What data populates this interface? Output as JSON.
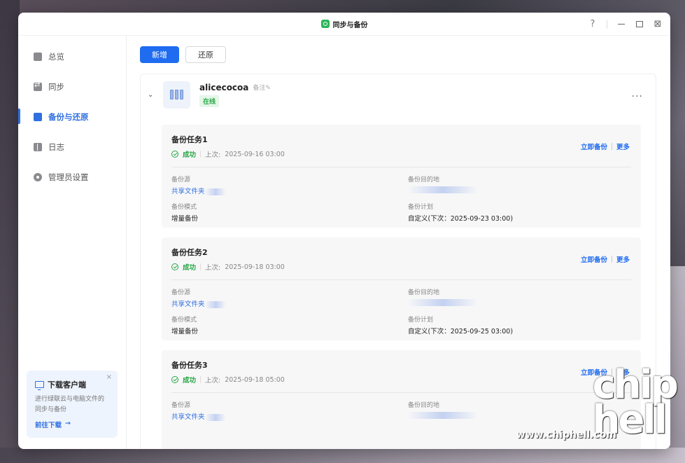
{
  "window": {
    "title": "同步与备份",
    "help": "?"
  },
  "sidebar": {
    "items": [
      {
        "label": "总览",
        "icon": "overview-icon"
      },
      {
        "label": "同步",
        "icon": "sync-icon"
      },
      {
        "label": "备份与还原",
        "icon": "backup-icon",
        "active": true
      },
      {
        "label": "日志",
        "icon": "log-icon"
      },
      {
        "label": "管理员设置",
        "icon": "gear-icon"
      }
    ],
    "download_card": {
      "title": "下载客户端",
      "desc": "进行绿联云与电脑文件的同步与备份",
      "link": "前往下载",
      "arrow": "→",
      "close": "×"
    }
  },
  "toolbar": {
    "add_label": "新增",
    "restore_label": "还原"
  },
  "device": {
    "chevron": "⌄",
    "name": "alicecocoa",
    "note": "备注✎",
    "status": "在线",
    "more": "···"
  },
  "tasks": [
    {
      "title": "备份任务1",
      "status": "成功",
      "last_label": "上次:",
      "last_time": "2025-09-16 03:00",
      "action_backup": "立即备份",
      "action_more": "更多",
      "source_label": "备份源",
      "source_value": "共享文件夹",
      "dest_label": "备份目的地",
      "mode_label": "备份模式",
      "mode_value": "增量备份",
      "plan_label": "备份计划",
      "plan_value": "自定义(下次：2025-09-23 03:00)"
    },
    {
      "title": "备份任务2",
      "status": "成功",
      "last_label": "上次:",
      "last_time": "2025-09-18 03:00",
      "action_backup": "立即备份",
      "action_more": "更多",
      "source_label": "备份源",
      "source_value": "共享文件夹",
      "dest_label": "备份目的地",
      "mode_label": "备份模式",
      "mode_value": "增量备份",
      "plan_label": "备份计划",
      "plan_value": "自定义(下次：2025-09-25 03:00)"
    },
    {
      "title": "备份任务3",
      "status": "成功",
      "last_label": "上次:",
      "last_time": "2025-09-18 05:00",
      "action_backup": "立即备份",
      "action_more": "更多",
      "source_label": "备份源",
      "source_value": "共享文件夹",
      "dest_label": "备份目的地"
    }
  ],
  "watermark": {
    "big": "chip hell",
    "small": "www.chiphell.com"
  },
  "colors": {
    "accent": "#1f6cf0",
    "success": "#28a745"
  }
}
